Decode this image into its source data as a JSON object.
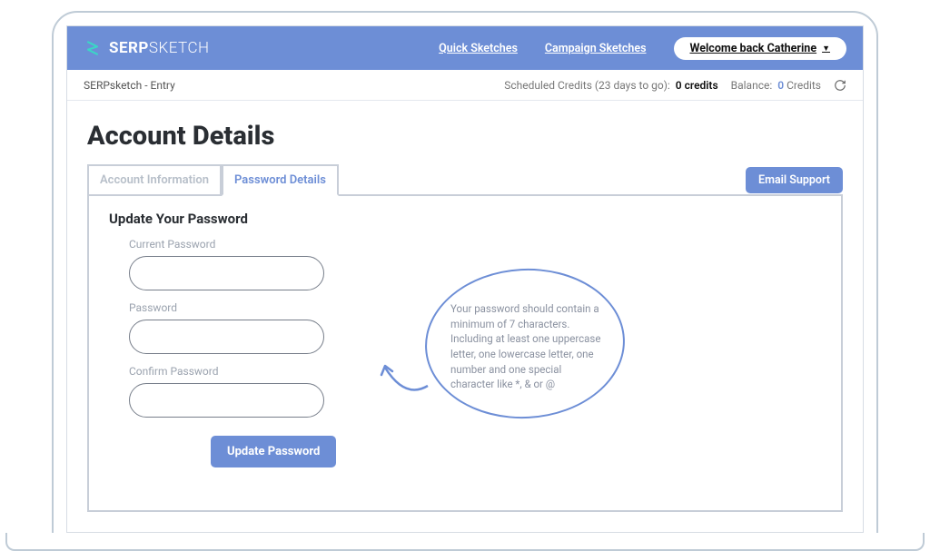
{
  "brand": {
    "bold": "SERP",
    "light": "SKETCH"
  },
  "nav": {
    "quick": "Quick Sketches",
    "campaign": "Campaign Sketches",
    "welcome": "Welcome back Catherine "
  },
  "subbar": {
    "breadcrumb": "SERPsketch - Entry",
    "scheduled_label": "Scheduled Credits (23 days to go):",
    "scheduled_value": "0 credits",
    "balance_label": "Balance:",
    "balance_value": "0",
    "balance_unit": "Credits"
  },
  "page": {
    "title": "Account Details",
    "tabs": {
      "account_info": "Account Information",
      "password_details": "Password Details"
    },
    "email_support": "Email Support"
  },
  "form": {
    "heading": "Update Your Password",
    "current_label": "Current Password",
    "new_label": "Password",
    "confirm_label": "Confirm Password",
    "submit": "Update Password"
  },
  "hint": "Your password should contain a minimum of 7 characters. Including at least one uppercase letter, one lowercase letter, one number and one special character like *, & or @"
}
